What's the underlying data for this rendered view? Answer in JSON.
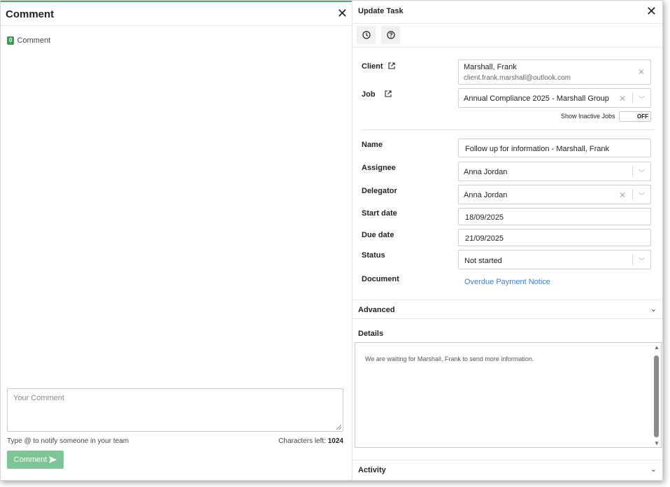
{
  "comment_panel": {
    "title": "Comment",
    "count": "0",
    "count_label": "Comment",
    "input_placeholder": "Your Comment",
    "hint": "Type @ to notify someone in your team",
    "chars_left_label": "Characters left:",
    "chars_left_value": "1024",
    "submit_label": "Comment",
    "submit_icon": "send-icon",
    "accent_color": "#4caf72"
  },
  "task_panel": {
    "title": "Update Task",
    "toolbar": [
      {
        "icon": "clock-icon"
      },
      {
        "icon": "help-icon"
      }
    ],
    "client": {
      "label": "Client",
      "name": "Marshall, Frank",
      "email": "client.frank.marshall@outlook.com"
    },
    "job": {
      "label": "Job",
      "value": "Annual Compliance 2025 - Marshall Group",
      "show_inactive_label": "Show Inactive Jobs",
      "toggle_state": "OFF"
    },
    "name": {
      "label": "Name",
      "value": "Follow up for information - Marshall, Frank"
    },
    "assignee": {
      "label": "Assignee",
      "value": "Anna Jordan"
    },
    "delegator": {
      "label": "Delegator",
      "value": "Anna Jordan"
    },
    "start_date": {
      "label": "Start date",
      "value": "18/09/2025"
    },
    "due_date": {
      "label": "Due date",
      "value": "21/09/2025"
    },
    "status": {
      "label": "Status",
      "value": "Not started"
    },
    "document": {
      "label": "Document",
      "link": "Overdue Payment Notice"
    },
    "advanced_label": "Advanced",
    "details": {
      "label": "Details",
      "text": "We are waiting for Marshall, Frank to send more information."
    },
    "activity_label": "Activity",
    "link_color": "#3a7fd2"
  }
}
